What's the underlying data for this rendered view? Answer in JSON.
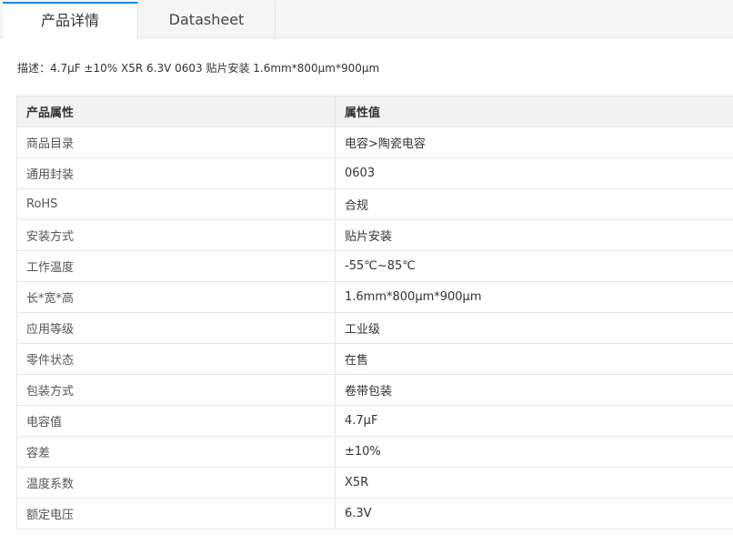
{
  "tabs": [
    {
      "label": "产品详情",
      "active": true
    },
    {
      "label": "Datasheet",
      "active": false
    }
  ],
  "description": {
    "label": "描述：",
    "text": "4.7μF ±10% X5R 6.3V 0603 贴片安装 1.6mm*800μm*900μm"
  },
  "table": {
    "headers": [
      "产品属性",
      "属性值"
    ],
    "rows": [
      {
        "name": "商品目录",
        "value": "电容>陶瓷电容"
      },
      {
        "name": "通用封装",
        "value": "0603"
      },
      {
        "name": "RoHS",
        "value": "合规"
      },
      {
        "name": "安装方式",
        "value": "贴片安装"
      },
      {
        "name": "工作温度",
        "value": "-55℃~85℃"
      },
      {
        "name": "长*宽*高",
        "value": "1.6mm*800μm*900μm"
      },
      {
        "name": "应用等级",
        "value": "工业级"
      },
      {
        "name": "零件状态",
        "value": "在售"
      },
      {
        "name": "包装方式",
        "value": "卷带包装"
      },
      {
        "name": "电容值",
        "value": "4.7μF"
      },
      {
        "name": "容差",
        "value": "±10%"
      },
      {
        "name": "温度系数",
        "value": "X5R"
      },
      {
        "name": "额定电压",
        "value": "6.3V"
      }
    ]
  },
  "colors": {
    "active_tab_accent": "#1e88e5",
    "header_bg": "#f2f2f2",
    "border": "#e6e6e6"
  }
}
